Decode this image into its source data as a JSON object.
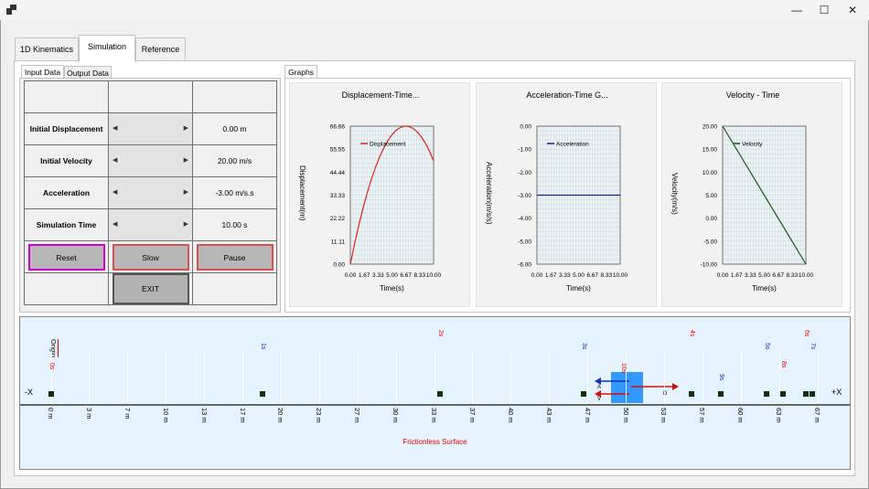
{
  "window": {
    "minimize": "—",
    "maximize": "☐",
    "close": "✕"
  },
  "main_tabs": [
    "1D Kinematics",
    "Simulation",
    "Reference"
  ],
  "input_tabs": [
    "Input Data",
    "Output Data"
  ],
  "graphs_tab": "Graphs",
  "inputs": [
    {
      "label": "Initial Displacement",
      "value": "0.00 m"
    },
    {
      "label": "Initial Velocity",
      "value": "20.00 m/s"
    },
    {
      "label": "Acceleration",
      "value": "-3.00 m/s.s"
    },
    {
      "label": "Simulation Time",
      "value": "10.00 s"
    }
  ],
  "buttons": {
    "reset": "Reset",
    "slow": "Slow",
    "pause": "Pause",
    "exit": "EXIT"
  },
  "chart_data": [
    {
      "type": "line",
      "title": "Displacement-Time...",
      "xlabel": "Time(s)",
      "ylabel": "Displacement(m)",
      "legend": "Displacement",
      "color": "#e02020",
      "x_ticks": [
        "0.00",
        "1.67",
        "3.33",
        "5.00",
        "6.67",
        "8.33",
        "10.00"
      ],
      "y_ticks": [
        "0.00",
        "11.11",
        "22.22",
        "33.33",
        "44.44",
        "55.55",
        "66.66"
      ],
      "xlim": [
        0,
        10
      ],
      "ylim": [
        0,
        66.66
      ],
      "x": [
        0,
        0.5,
        1,
        1.5,
        2,
        2.5,
        3,
        3.5,
        4,
        4.5,
        5,
        5.5,
        6,
        6.5,
        6.67,
        7,
        7.5,
        8,
        8.5,
        9,
        9.5,
        10
      ],
      "y": [
        0,
        9.63,
        18.5,
        26.63,
        34,
        40.63,
        46.5,
        51.63,
        56,
        59.63,
        62.5,
        64.63,
        66,
        66.63,
        66.67,
        66.5,
        65.63,
        64,
        61.63,
        58.5,
        54.63,
        50
      ]
    },
    {
      "type": "line",
      "title": "Acceleration-Time  G...",
      "xlabel": "Time(s)",
      "ylabel": "Acceleration(m/s/s)",
      "legend": "Acceleration",
      "color": "#1020a0",
      "x_ticks": [
        "0.00",
        "1.67",
        "3.33",
        "5.00",
        "6.67",
        "8.33",
        "10.00"
      ],
      "y_ticks": [
        "0.00",
        "-1.00",
        "-2.00",
        "-3.00",
        "-4.00",
        "-5.00",
        "-6.00"
      ],
      "xlim": [
        0,
        10
      ],
      "ylim": [
        -6,
        0
      ],
      "x": [
        0,
        10
      ],
      "y": [
        -3,
        -3
      ]
    },
    {
      "type": "line",
      "title": "Velocity - Time",
      "xlabel": "Time(s)",
      "ylabel": "Velocity(m/s)",
      "legend": "Velocity",
      "color": "#205020",
      "x_ticks": [
        "0.00",
        "1.67",
        "3.33",
        "5.00",
        "6.67",
        "8.33",
        "10.00"
      ],
      "y_ticks": [
        "20.00",
        "15.00",
        "10.00",
        "5.00",
        "0.00",
        "-5.00",
        "-10.00"
      ],
      "xlim": [
        0,
        10
      ],
      "ylim": [
        -10,
        20
      ],
      "x": [
        0,
        10
      ],
      "y": [
        20,
        -10
      ]
    }
  ],
  "sim": {
    "minus_x": "-X",
    "plus_x": "+X",
    "origin": "Origin",
    "surface": "Frictionless Surface",
    "ticks": [
      "0 m",
      "3 m",
      "7 m",
      "10 m",
      "13 m",
      "17 m",
      "20 m",
      "23 m",
      "27 m",
      "30 m",
      "33 m",
      "37 m",
      "40 m",
      "43 m",
      "47 m",
      "50 m",
      "53 m",
      "57 m",
      "60 m",
      "63 m",
      "67 m"
    ],
    "time_marks": [
      {
        "label": "0s",
        "color": "red",
        "pos_m": 0
      },
      {
        "label": "1s",
        "color": "blue",
        "pos_m": 18.5
      },
      {
        "label": "2s",
        "color": "red",
        "pos_m": 34
      },
      {
        "label": "3s",
        "color": "blue",
        "pos_m": 46.5
      },
      {
        "label": "4s",
        "color": "red",
        "pos_m": 56
      },
      {
        "label": "5s",
        "color": "blue",
        "pos_m": 62.5
      },
      {
        "label": "6s",
        "color": "red",
        "pos_m": 66
      },
      {
        "label": "7s",
        "color": "blue",
        "pos_m": 66.5
      },
      {
        "label": "8s",
        "color": "red",
        "pos_m": 64
      },
      {
        "label": "9s",
        "color": "blue",
        "pos_m": 58.5
      },
      {
        "label": "10s",
        "color": "red",
        "pos_m": 50
      }
    ],
    "block_labels": {
      "a": "A",
      "v": "V",
      "d": "D"
    }
  }
}
